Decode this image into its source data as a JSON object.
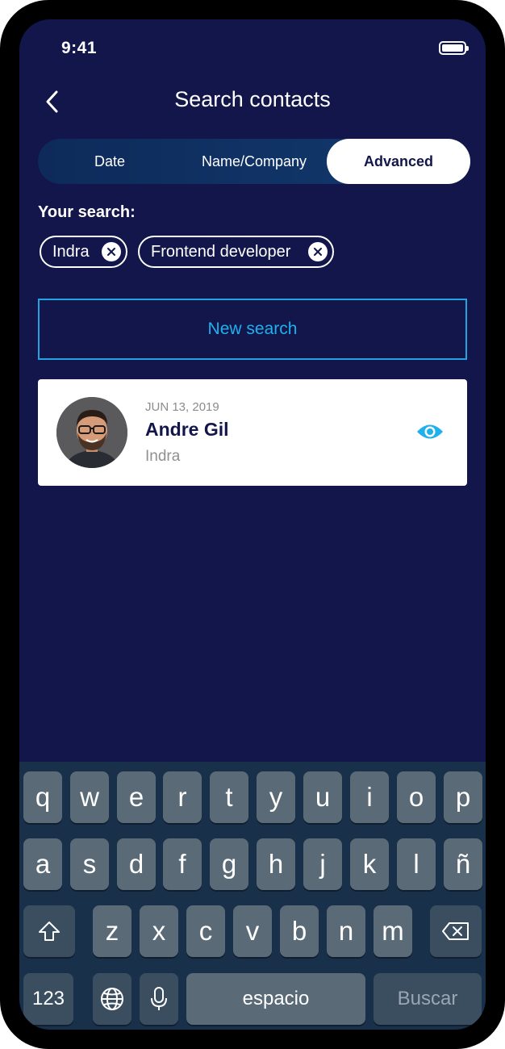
{
  "status_bar": {
    "time": "9:41"
  },
  "header": {
    "title": "Search contacts"
  },
  "tabs": [
    {
      "label": "Date",
      "active": false
    },
    {
      "label": "Name/Company",
      "active": false
    },
    {
      "label": "Advanced",
      "active": true
    }
  ],
  "search": {
    "heading": "Your search:",
    "chips": [
      "Indra",
      "Frontend developer"
    ],
    "new_search_label": "New search"
  },
  "results": [
    {
      "date": "JUN 13, 2019",
      "name": "Andre Gil",
      "company": "Indra"
    }
  ],
  "keyboard": {
    "row1": [
      "q",
      "w",
      "e",
      "r",
      "t",
      "y",
      "u",
      "i",
      "o",
      "p"
    ],
    "row2": [
      "a",
      "s",
      "d",
      "f",
      "g",
      "h",
      "j",
      "k",
      "l",
      "ñ"
    ],
    "row3": [
      "z",
      "x",
      "c",
      "v",
      "b",
      "n",
      "m"
    ],
    "numbers_label": "123",
    "space_label": "espacio",
    "action_label": "Buscar"
  },
  "colors": {
    "background": "#12164a",
    "accent": "#1fb0ee",
    "keyboard": "#19304a"
  }
}
